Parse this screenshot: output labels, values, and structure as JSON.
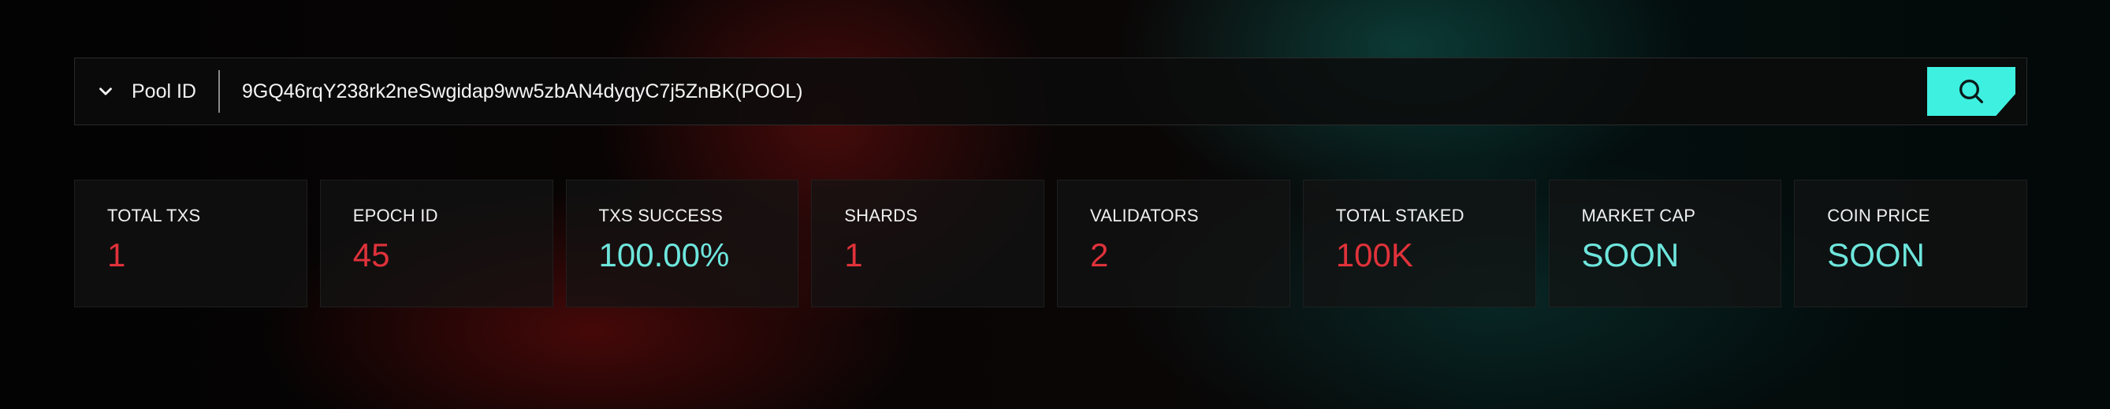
{
  "search": {
    "selector_label": "Pool ID",
    "query": "9GQ46rqY238rk2neSwgidap9ww5zbAN4dyqyC7j5ZnBK(POOL)"
  },
  "colors": {
    "accent_teal": "#3ef0e0",
    "value_red": "#e0323a",
    "value_teal": "#6ee6dc"
  },
  "stats": [
    {
      "label": "TOTAL TXS",
      "value": "1",
      "tone": "red"
    },
    {
      "label": "EPOCH ID",
      "value": "45",
      "tone": "red"
    },
    {
      "label": "TXS SUCCESS",
      "value": "100.00%",
      "tone": "teal"
    },
    {
      "label": "SHARDS",
      "value": "1",
      "tone": "red"
    },
    {
      "label": "VALIDATORS",
      "value": "2",
      "tone": "red"
    },
    {
      "label": "TOTAL STAKED",
      "value": "100K",
      "tone": "red"
    },
    {
      "label": "MARKET CAP",
      "value": "SOON",
      "tone": "teal"
    },
    {
      "label": "COIN PRICE",
      "value": "SOON",
      "tone": "teal"
    }
  ],
  "icons": {
    "dropdown": "chevron-down-icon",
    "search": "search-icon"
  }
}
